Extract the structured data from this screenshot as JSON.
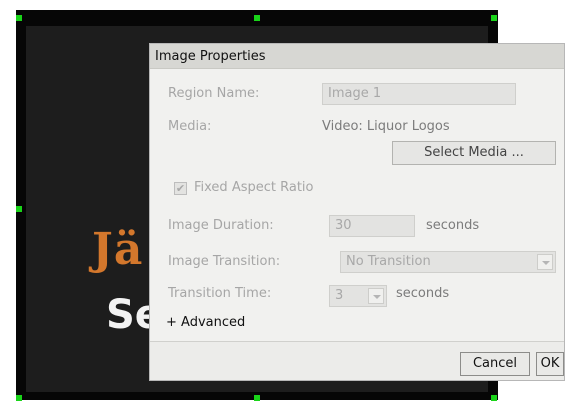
{
  "background_media": {
    "logo_text_top": "Jä",
    "logo_text_bottom": "Se",
    "accent_color": "#d3772c"
  },
  "dialog": {
    "title": "Image Properties",
    "region_name_label": "Region Name:",
    "region_name_value": "Image 1",
    "media_label": "Media:",
    "media_value": "Video: Liquor Logos",
    "select_media_label": "Select Media ...",
    "fixed_aspect_label": "Fixed Aspect Ratio",
    "fixed_aspect_checked": true,
    "image_duration_label": "Image Duration:",
    "image_duration_value": "30",
    "image_duration_unit": "seconds",
    "image_transition_label": "Image Transition:",
    "image_transition_value": "No Transition",
    "transition_time_label": "Transition Time:",
    "transition_time_value": "3",
    "transition_time_unit": "seconds",
    "advanced_label": "+ Advanced",
    "cancel_label": "Cancel",
    "ok_label": "OK"
  },
  "colors": {
    "handle": "#19d419",
    "dialog_bg": "#f1f1ef",
    "disabled_text": "#a6a6a6"
  },
  "icons": {
    "checkbox": "checkmark-icon",
    "dropdown": "chevron-down-icon"
  }
}
